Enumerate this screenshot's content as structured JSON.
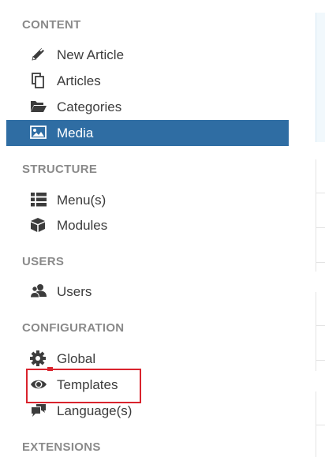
{
  "sections": {
    "content": {
      "heading": "CONTENT",
      "items": [
        {
          "label": "New Article",
          "icon": "pencil-icon"
        },
        {
          "label": "Articles",
          "icon": "copy-icon"
        },
        {
          "label": "Categories",
          "icon": "folder-open-icon"
        },
        {
          "label": "Media",
          "icon": "image-icon",
          "active": true
        }
      ]
    },
    "structure": {
      "heading": "STRUCTURE",
      "items": [
        {
          "label": "Menu(s)",
          "icon": "list-icon"
        },
        {
          "label": "Modules",
          "icon": "cube-icon"
        }
      ]
    },
    "users": {
      "heading": "USERS",
      "items": [
        {
          "label": "Users",
          "icon": "users-icon"
        }
      ]
    },
    "configuration": {
      "heading": "CONFIGURATION",
      "items": [
        {
          "label": "Global",
          "icon": "gear-icon"
        },
        {
          "label": "Templates",
          "icon": "eye-icon",
          "highlighted": true
        },
        {
          "label": "Language(s)",
          "icon": "comments-icon"
        }
      ]
    },
    "extensions": {
      "heading": "EXTENSIONS"
    }
  },
  "colors": {
    "active_background": "#2f6da3",
    "active_text": "#ffffff",
    "heading_text": "#8a8a8a",
    "item_text": "#3c3c3c",
    "highlight_border": "#d9232d"
  }
}
